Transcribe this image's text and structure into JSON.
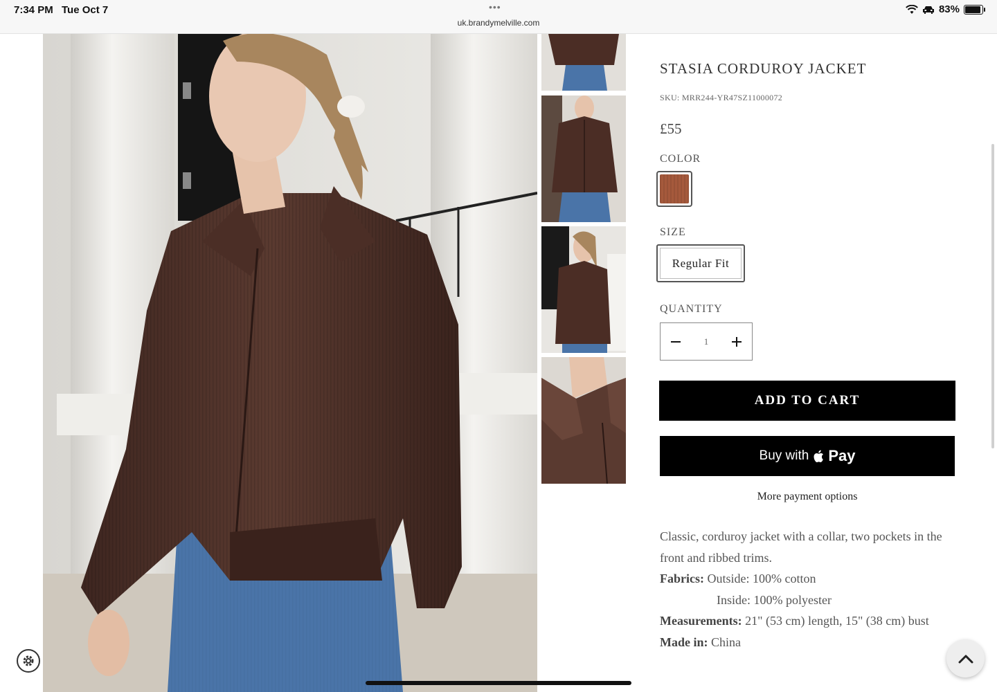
{
  "status_bar": {
    "time": "7:34 PM",
    "date": "Tue Oct 7",
    "url": "uk.brandymelville.com",
    "battery": "83%",
    "icons": [
      "wifi-icon",
      "car-icon",
      "battery-icon"
    ]
  },
  "gallery": {
    "main_image_alt": "Model wearing brown corduroy jacket and jeans",
    "thumbnails": [
      "jacket-back-thumb",
      "jacket-front-thumb",
      "jacket-side-thumb",
      "collar-closeup-thumb"
    ]
  },
  "product": {
    "title": "STASIA CORDUROY JACKET",
    "sku": "SKU: MRR244-YR47SZ11000072",
    "price": "£55",
    "color_label": "COLOR",
    "color_swatch": "#a5593c",
    "size_label": "SIZE",
    "size_value": "Regular Fit",
    "quantity_label": "QUANTITY",
    "quantity": "1",
    "add_to_cart": "ADD TO CART",
    "apple_pay_buy": "Buy with",
    "apple_pay_brand": "Pay",
    "more_payment": "More payment options"
  },
  "description": {
    "intro": "Classic, corduroy jacket with a collar, two pockets in the front and ribbed trims.",
    "fabrics_label": "Fabrics:",
    "fabrics_outside": "Outside: 100% cotton",
    "fabrics_inside": "Inside: 100% polyester",
    "measurements_label": "Measurements:",
    "measurements_value": "21\" (53 cm) length, 15\" (38 cm) bust",
    "made_in_label": "Made in:",
    "made_in_value": "China"
  }
}
